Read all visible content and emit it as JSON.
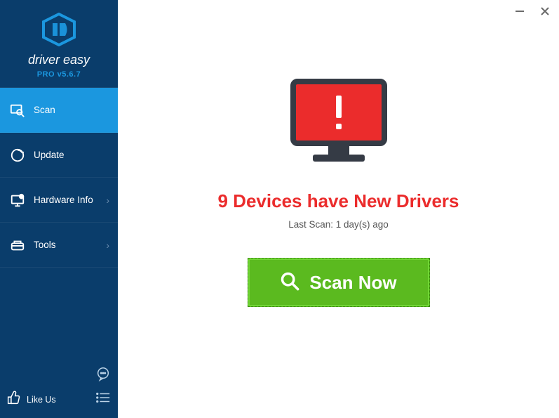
{
  "brand": {
    "name": "driver easy",
    "version": "PRO v5.6.7"
  },
  "sidebar": {
    "items": [
      {
        "label": "Scan"
      },
      {
        "label": "Update"
      },
      {
        "label": "Hardware Info"
      },
      {
        "label": "Tools"
      }
    ],
    "like_us": "Like Us"
  },
  "main": {
    "headline": "9 Devices have New Drivers",
    "subline": "Last Scan: 1 day(s) ago",
    "scan_button": "Scan Now"
  },
  "colors": {
    "sidebar_bg": "#0a3d6b",
    "accent": "#1b97df",
    "alert": "#eb2c2c",
    "scan_btn": "#5bba1f"
  }
}
